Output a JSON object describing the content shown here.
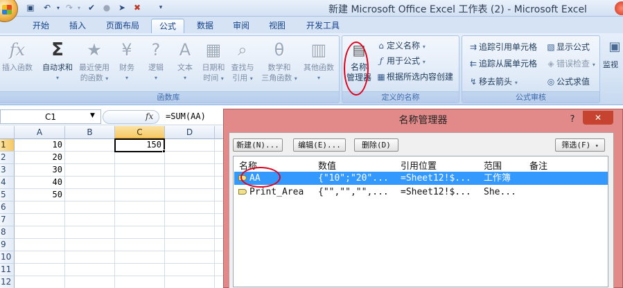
{
  "window": {
    "title": "新建 Microsoft Office Excel 工作表 (2) - Microsoft Excel"
  },
  "tabs": [
    "开始",
    "插入",
    "页面布局",
    "公式",
    "数据",
    "审阅",
    "视图",
    "开发工具"
  ],
  "ribbon": {
    "function_library": {
      "label": "函数库",
      "insert_function": "插入函数",
      "autosum": "自动求和",
      "recent": [
        "最近使用",
        "的函数"
      ],
      "financial": "财务",
      "logical": "逻辑",
      "text": "文本",
      "datetime": [
        "日期和",
        "时间"
      ],
      "lookup": [
        "查找与",
        "引用"
      ],
      "math": [
        "数学和",
        "三角函数"
      ],
      "more": "其他函数"
    },
    "defined_names": {
      "label": "定义的名称",
      "name_manager": [
        "名称",
        "管理器"
      ],
      "define_name": "定义名称",
      "use_in_formula": "用于公式",
      "create_from_selection": "根据所选内容创建"
    },
    "formula_auditing": {
      "label": "公式审核",
      "trace_precedents": "追踪引用单元格",
      "trace_dependents": "追踪从属单元格",
      "remove_arrows": "移去箭头",
      "show_formulas": "显示公式",
      "error_checking": "错误检查",
      "evaluate_formula": "公式求值",
      "watch_window": "监视"
    }
  },
  "formula_bar": {
    "name_box": "C1",
    "fx": "fx",
    "formula": "=SUM(AA)"
  },
  "sheet": {
    "columns": [
      "A",
      "B",
      "C",
      "D"
    ],
    "rows": [
      "1",
      "2",
      "3",
      "4",
      "5",
      "6",
      "7",
      "8",
      "9",
      "10",
      "11",
      "12"
    ],
    "col_a_values": [
      "10",
      "20",
      "30",
      "40",
      "50"
    ],
    "c1_value": "150"
  },
  "dialog": {
    "title": "名称管理器",
    "help": "?",
    "close": "✕",
    "buttons": {
      "new": "新建(N)...",
      "edit": "编辑(E)...",
      "delete": "删除(D)",
      "filter": "筛选(F)"
    },
    "headers": [
      "名称",
      "数值",
      "引用位置",
      "范围",
      "备注"
    ],
    "rows": [
      {
        "name": "AA",
        "value": "{\"10\";\"20\"...",
        "refers_to": "=Sheet12!$...",
        "scope": "工作簿",
        "comment": ""
      },
      {
        "name": "Print_Area",
        "value": "{\"\",\"\",\"\",...",
        "refers_to": "=Sheet12!$...",
        "scope": "She...",
        "comment": ""
      }
    ]
  }
}
